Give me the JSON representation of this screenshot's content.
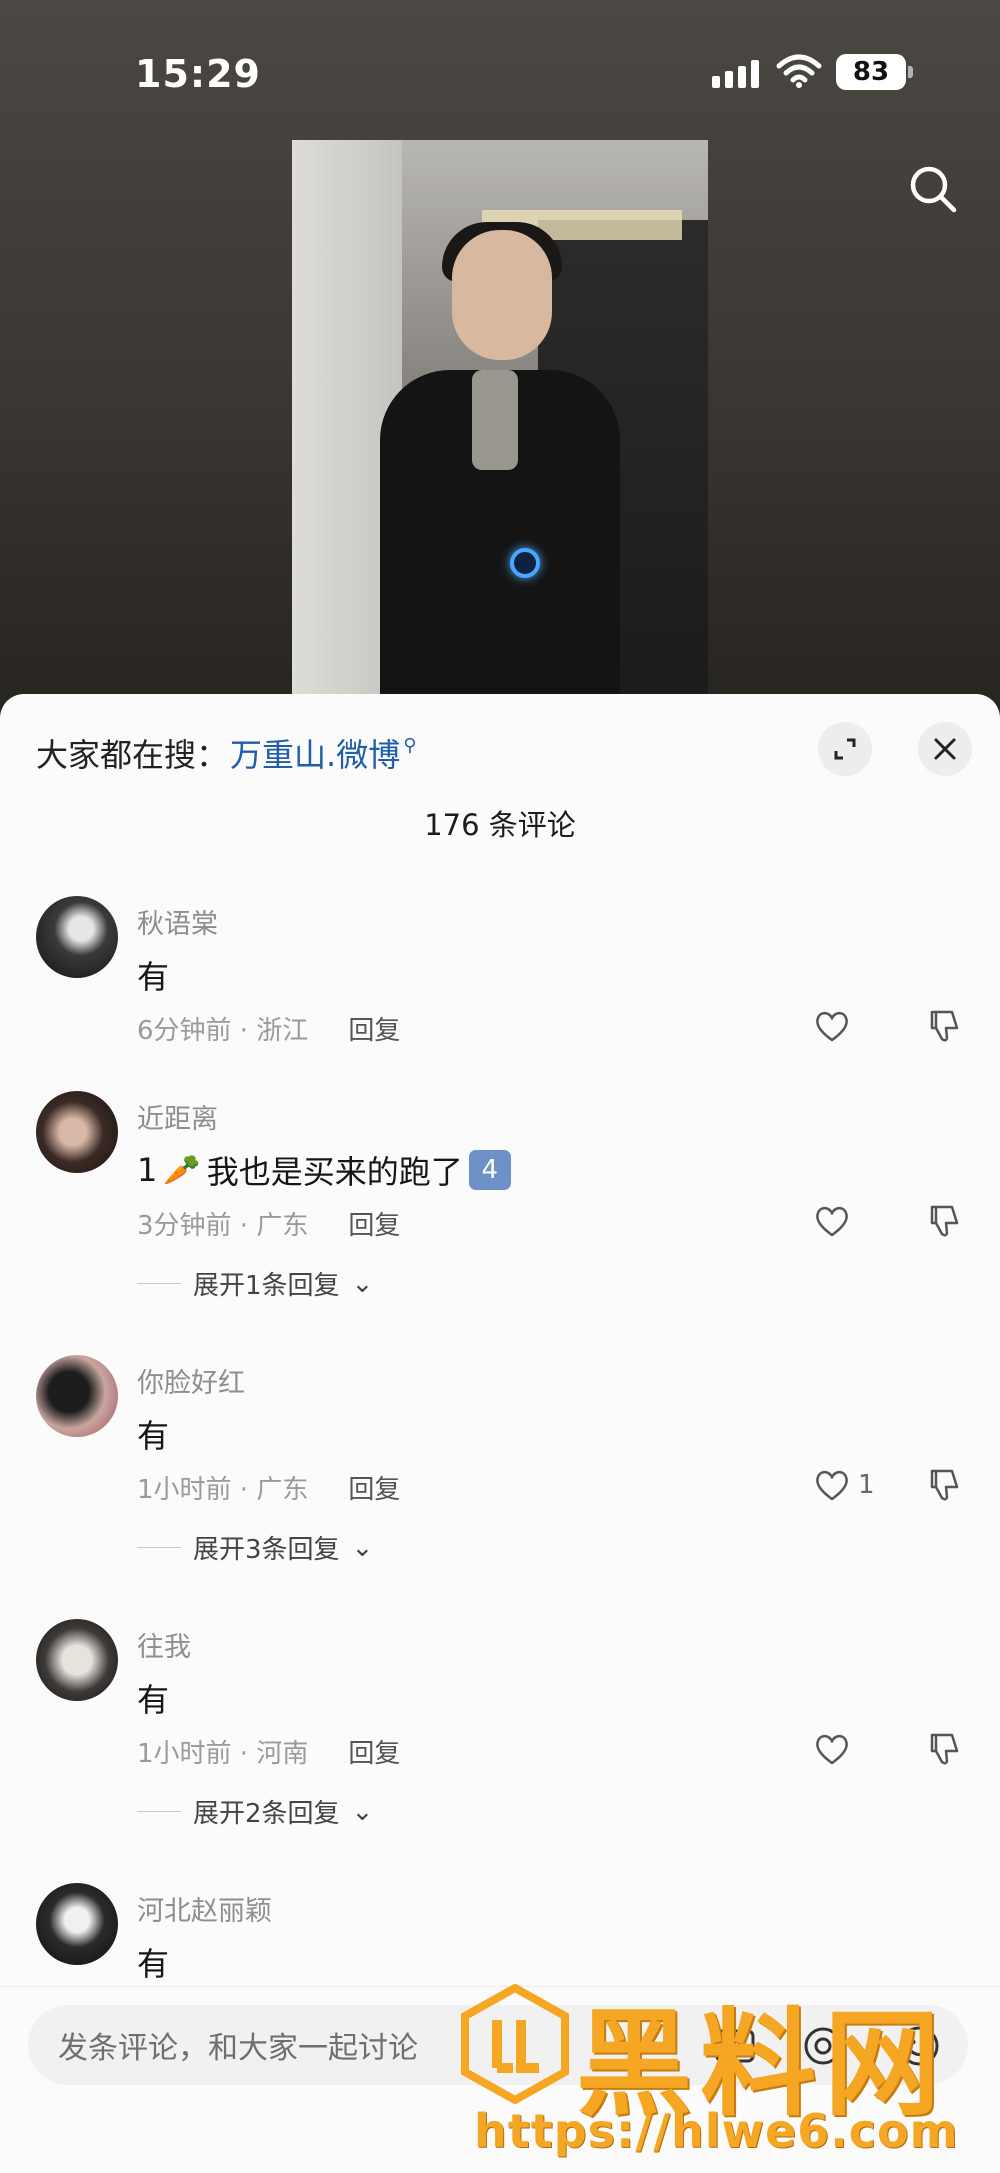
{
  "status_bar": {
    "time": "15:29",
    "battery": "83"
  },
  "sheet": {
    "hot_search_label": "大家都在搜：",
    "hot_search_keyword": "万重山.微博",
    "comment_count": "176 条评论"
  },
  "comments": [
    {
      "user": "秋语棠",
      "text": "有",
      "time_location": "6分钟前 · 浙江",
      "reply_label": "回复",
      "likes": ""
    },
    {
      "user": "近距离",
      "text_prefix": "1",
      "text_main": "我也是买来的跑了",
      "badge": "4",
      "time_location": "3分钟前 · 广东",
      "reply_label": "回复",
      "likes": "",
      "expand_replies": "展开1条回复"
    },
    {
      "user": "你脸好红",
      "text": "有",
      "time_location": "1小时前 · 广东",
      "reply_label": "回复",
      "likes": "1",
      "expand_replies": "展开3条回复"
    },
    {
      "user": "往我",
      "text": "有",
      "time_location": "1小时前 · 河南",
      "reply_label": "回复",
      "likes": "",
      "expand_replies": "展开2条回复"
    },
    {
      "user": "河北赵丽颖",
      "text": "有"
    }
  ],
  "composer": {
    "placeholder": "发条评论，和大家一起讨论"
  },
  "watermark": {
    "text": "黑料网",
    "url": "https://hlwe6.com"
  },
  "colors": {
    "link_blue": "#1f5ea8",
    "watermark_orange": "#f5a623"
  }
}
